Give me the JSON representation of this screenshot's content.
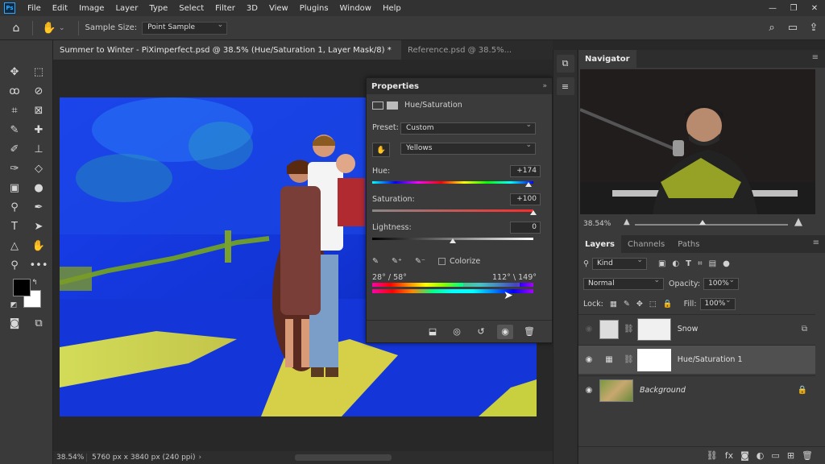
{
  "menubar": {
    "app_icon": "Ps",
    "items": [
      "File",
      "Edit",
      "Image",
      "Layer",
      "Type",
      "Select",
      "Filter",
      "3D",
      "View",
      "Plugins",
      "Window",
      "Help"
    ],
    "window_controls": [
      "—",
      "❐",
      "✕"
    ]
  },
  "options": {
    "sample_size_label": "Sample Size:",
    "sample_size_value": "Point Sample"
  },
  "tabs": [
    {
      "label": "Summer to Winter - PiXimperfect.psd @ 38.5% (Hue/Saturation 1, Layer Mask/8) *",
      "active": true
    },
    {
      "label": "Reference.psd @ 38.5%...",
      "active": false
    }
  ],
  "status": {
    "zoom": "38.54%",
    "doc_info": "5760 px x 3840 px (240 ppi)",
    "arrow": "›"
  },
  "properties": {
    "title": "Properties",
    "collapse": "»",
    "adjustment_name": "Hue/Saturation",
    "preset_label": "Preset:",
    "preset_value": "Custom",
    "channel_value": "Yellows",
    "hue_label": "Hue:",
    "hue_value": "+174",
    "saturation_label": "Saturation:",
    "saturation_value": "+100",
    "lightness_label": "Lightness:",
    "lightness_value": "0",
    "colorize_label": "Colorize",
    "range_left": "28° / 58°",
    "range_right": "112° \\ 149°",
    "hue_level": 0.97,
    "saturation_level": 1.0,
    "lightness_level": 0.5
  },
  "navigator": {
    "tab": "Navigator",
    "zoom": "38.54%"
  },
  "layers": {
    "tabs": [
      "Layers",
      "Channels",
      "Paths"
    ],
    "filter_value": "Kind",
    "blend_mode": "Normal",
    "opacity_label": "Opacity:",
    "opacity_value": "100%",
    "lock_label": "Lock:",
    "fill_label": "Fill:",
    "fill_value": "100%",
    "items": [
      {
        "name": "Snow",
        "visible": false,
        "selected": false
      },
      {
        "name": "Hue/Saturation 1",
        "visible": true,
        "selected": true
      },
      {
        "name": "Background",
        "visible": true,
        "selected": false,
        "locked": true
      }
    ]
  },
  "icons": {
    "home": "home-icon",
    "hand": "hand-tool-icon",
    "search": "search-icon",
    "workspace": "workspace-icon",
    "share": "share-icon"
  },
  "colors": {
    "accent_blue": "#31a8ff",
    "panel_bg": "#3a3a3a",
    "dark_bg": "#282828"
  }
}
